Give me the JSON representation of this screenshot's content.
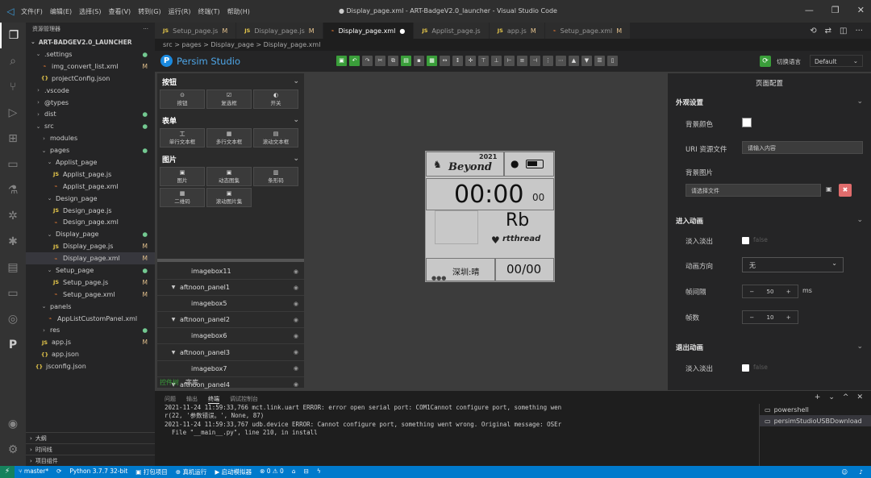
{
  "titlebar": {
    "menu": [
      "文件(F)",
      "编辑(E)",
      "选择(S)",
      "查看(V)",
      "转到(G)",
      "运行(R)",
      "终端(T)",
      "帮助(H)"
    ],
    "window_title": "● Display_page.xml - ART-BadgeV2.0_launcher - Visual Studio Code"
  },
  "explorer": {
    "header": "资源管理器",
    "project": "ART-BADGEV2.0_LAUNCHER",
    "tree": [
      {
        "label": ".settings",
        "indent": 1,
        "chevron": "down",
        "type": "folder",
        "status": "dot"
      },
      {
        "label": "img_convert_list.xml",
        "indent": 2,
        "type": "xml",
        "status": "M"
      },
      {
        "label": "projectConfig.json",
        "indent": 2,
        "type": "json",
        "status": ""
      },
      {
        "label": ".vscode",
        "indent": 1,
        "chevron": "right",
        "type": "folder",
        "status": ""
      },
      {
        "label": "@types",
        "indent": 1,
        "chevron": "right",
        "type": "folder",
        "status": ""
      },
      {
        "label": "dist",
        "indent": 1,
        "chevron": "right",
        "type": "folder",
        "status": "dot"
      },
      {
        "label": "src",
        "indent": 1,
        "chevron": "down",
        "type": "folder",
        "status": "dot"
      },
      {
        "label": "modules",
        "indent": 2,
        "chevron": "right",
        "type": "folder",
        "status": ""
      },
      {
        "label": "pages",
        "indent": 2,
        "chevron": "down",
        "type": "folder",
        "status": "dot"
      },
      {
        "label": "Applist_page",
        "indent": 3,
        "chevron": "down",
        "type": "folder",
        "status": ""
      },
      {
        "label": "Applist_page.js",
        "indent": 4,
        "type": "js",
        "status": ""
      },
      {
        "label": "Applist_page.xml",
        "indent": 4,
        "type": "xml",
        "status": ""
      },
      {
        "label": "Design_page",
        "indent": 3,
        "chevron": "down",
        "type": "folder",
        "status": ""
      },
      {
        "label": "Design_page.js",
        "indent": 4,
        "type": "js",
        "status": ""
      },
      {
        "label": "Design_page.xml",
        "indent": 4,
        "type": "xml",
        "status": ""
      },
      {
        "label": "Display_page",
        "indent": 3,
        "chevron": "down",
        "type": "folder",
        "status": "dot"
      },
      {
        "label": "Display_page.js",
        "indent": 4,
        "type": "js",
        "status": "M"
      },
      {
        "label": "Display_page.xml",
        "indent": 4,
        "type": "xml",
        "status": "M",
        "selected": true
      },
      {
        "label": "Setup_page",
        "indent": 3,
        "chevron": "down",
        "type": "folder",
        "status": "dot"
      },
      {
        "label": "Setup_page.js",
        "indent": 4,
        "type": "js",
        "status": "M"
      },
      {
        "label": "Setup_page.xml",
        "indent": 4,
        "type": "xml",
        "status": "M"
      },
      {
        "label": "panels",
        "indent": 2,
        "chevron": "down",
        "type": "folder",
        "status": ""
      },
      {
        "label": "AppListCustomPanel.xml",
        "indent": 3,
        "type": "xml",
        "status": ""
      },
      {
        "label": "res",
        "indent": 2,
        "chevron": "right",
        "type": "folder",
        "status": "dot"
      },
      {
        "label": "app.js",
        "indent": 2,
        "type": "js",
        "status": "M"
      },
      {
        "label": "app.json",
        "indent": 2,
        "type": "json",
        "status": ""
      },
      {
        "label": "jsconfig.json",
        "indent": 1,
        "type": "json",
        "status": ""
      }
    ],
    "outline": [
      "大纲",
      "时间线",
      "项目组件"
    ]
  },
  "tabs": [
    {
      "label": "Setup_page.js",
      "type": "js",
      "mark": "M"
    },
    {
      "label": "Display_page.js",
      "type": "js",
      "mark": "M"
    },
    {
      "label": "Display_page.xml",
      "type": "xml",
      "mark": "●",
      "active": true
    },
    {
      "label": "Applist_page.js",
      "type": "js",
      "mark": ""
    },
    {
      "label": "app.js",
      "type": "js",
      "mark": "M"
    },
    {
      "label": "Setup_page.xml",
      "type": "xml",
      "mark": "M"
    }
  ],
  "breadcrumb": "src > pages > Display_page > Display_page.xml",
  "persim": {
    "name": "Persim Studio",
    "lang_label": "切换语言",
    "lang_value": "Default",
    "sections": [
      {
        "title": "按钮",
        "items": [
          {
            "icon": "⊙",
            "label": "按钮"
          },
          {
            "icon": "☑",
            "label": "复选框"
          },
          {
            "icon": "◐",
            "label": "开关"
          }
        ]
      },
      {
        "title": "表单",
        "items": [
          {
            "icon": "工",
            "label": "单行文本框"
          },
          {
            "icon": "▦",
            "label": "多行文本框"
          },
          {
            "icon": "▤",
            "label": "滚动文本框"
          }
        ]
      },
      {
        "title": "图片",
        "items": [
          {
            "icon": "▣",
            "label": "图片"
          },
          {
            "icon": "▣",
            "label": "动态图集"
          },
          {
            "icon": "▥",
            "label": "条形码"
          },
          {
            "icon": "▦",
            "label": "二维码"
          },
          {
            "icon": "▣",
            "label": "滚动图片集"
          }
        ]
      }
    ],
    "layers": [
      {
        "label": "imagebox11",
        "level": 2
      },
      {
        "label": "aftnoon_panel1",
        "level": 1
      },
      {
        "label": "imagebox5",
        "level": 2
      },
      {
        "label": "aftnoon_panel2",
        "level": 1
      },
      {
        "label": "imagebox6",
        "level": 2
      },
      {
        "label": "aftnoon_panel3",
        "level": 1
      },
      {
        "label": "imagebox7",
        "level": 2
      },
      {
        "label": "aftnoon_panel4",
        "level": 1
      }
    ],
    "layer_tabs": [
      "控件树",
      "字库"
    ],
    "device": {
      "year": "2021",
      "brand": "Beyond",
      "time": "00:00",
      "seconds": "00",
      "element": "Rb",
      "footer_brand": "rtthread",
      "weather": "深圳:晴",
      "date": "00/00"
    }
  },
  "props": {
    "title": "页面配置",
    "appearance": {
      "group": "外观设置",
      "bg_color_label": "背景颜色",
      "uri_label": "URI 资源文件",
      "uri_placeholder": "请输入内容",
      "bg_image_label": "背景图片",
      "bg_image_placeholder": "请选择文件"
    },
    "enter": {
      "group": "进入动画",
      "fade_label": "淡入淡出",
      "fade_value": "false",
      "dir_label": "动画方向",
      "dir_value": "无",
      "interval_label": "帧间隔",
      "interval_value": "50",
      "interval_unit": "ms",
      "frames_label": "帧数",
      "frames_value": "10"
    },
    "exit": {
      "group": "退出动画",
      "fade_label": "淡入淡出",
      "fade_value": "false"
    }
  },
  "panel": {
    "tabs": [
      "问题",
      "输出",
      "终端",
      "调试控制台"
    ],
    "active_tab": "终端",
    "terminal_lines": [
      "2021-11-24 11:59:33,766 mct.link.uart ERROR: error open serial port: COM1Cannot configure port, something wen",
      "r(22, '参数错误。', None, 87)",
      "2021-11-24 11:59:33,767 udb.device ERROR: Cannot configure port, something went wrong. Original message: OSEr",
      "  File \"__main__.py\", line 210, in install"
    ],
    "terminals": [
      "powershell",
      "persimStudioUSBDownload"
    ]
  },
  "status": {
    "branch": "master*",
    "python": "Python 3.7.7 32-bit",
    "items": [
      "打包项目",
      "真机运行",
      "启动模拟器"
    ],
    "problems": "⊗ 0 ⚠ 0"
  },
  "colors": {
    "accent": "#007acc",
    "persim_blue": "#4ea6e8",
    "modified": "#e2c08d",
    "untracked": "#73c991"
  }
}
